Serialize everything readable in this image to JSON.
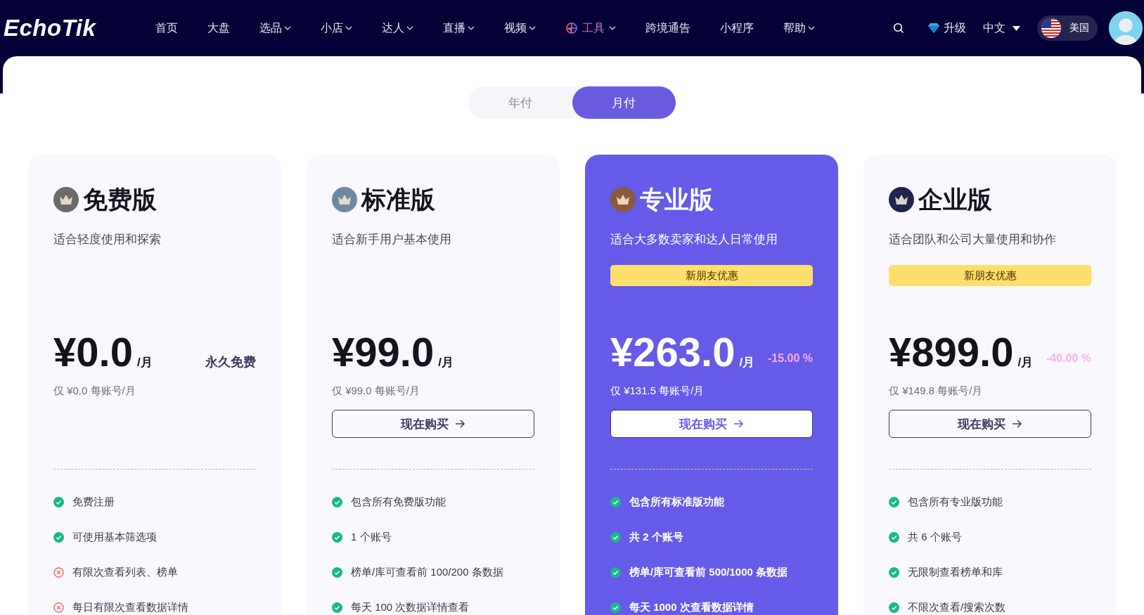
{
  "nav": {
    "logo": "EchoTik",
    "items": [
      {
        "label": "首页",
        "kind": "plain"
      },
      {
        "label": "大盘",
        "kind": "plain"
      },
      {
        "label": "选品",
        "kind": "dropdown"
      },
      {
        "label": "小店",
        "kind": "dropdown"
      },
      {
        "label": "达人",
        "kind": "dropdown"
      },
      {
        "label": "直播",
        "kind": "dropdown"
      },
      {
        "label": "视频",
        "kind": "dropdown"
      },
      {
        "label": "工具",
        "kind": "featured"
      },
      {
        "label": "跨境通告",
        "kind": "plain"
      },
      {
        "label": "小程序",
        "kind": "plain"
      },
      {
        "label": "帮助",
        "kind": "dropdown"
      }
    ],
    "upgrade": "升级",
    "language": "中文",
    "region": "美国"
  },
  "billing_options": [
    {
      "label": "年付",
      "selected": false
    },
    {
      "label": "月付",
      "selected": true
    }
  ],
  "plans": [
    {
      "name": "免费版",
      "color": "#6b6b6b",
      "selected": false,
      "description": "适合轻度使用和探索",
      "price": "¥0.0",
      "unit": "/月",
      "note": "永久免费",
      "per_account": "仅 ¥0.0 每账号/月",
      "features": [
        {
          "text": "免费注册",
          "kind": "check"
        },
        {
          "text": "可使用基本筛选项",
          "kind": "check"
        },
        {
          "text": "有限次查看列表、榜单",
          "kind": "cross"
        },
        {
          "text": "每日有限次查看数据详情",
          "kind": "cross"
        }
      ]
    },
    {
      "name": "标准版",
      "color": "#6f89a3",
      "selected": false,
      "description": "适合新手用户基本使用",
      "price": "¥99.0",
      "unit": "/月",
      "per_account": "仅 ¥99.0 每账号/月",
      "button": "现在购买",
      "features": [
        {
          "text": "包含所有免费版功能",
          "kind": "check"
        },
        {
          "text": "1 个账号",
          "kind": "check"
        },
        {
          "text": "榜单/库可查看前 100/200 条数据",
          "kind": "check"
        },
        {
          "text": "每天 100 次数据详情查看",
          "kind": "check"
        }
      ]
    },
    {
      "name": "专业版",
      "color": "#8a5a3c",
      "selected": true,
      "description": "适合大多数卖家和达人日常使用",
      "badge": "新朋友优惠",
      "price": "¥263.0",
      "unit": "/月",
      "discount": "-15.00 %",
      "per_account": "仅 ¥131.5 每账号/月",
      "button": "现在购买",
      "features": [
        {
          "text": "包含所有标准版功能",
          "kind": "check"
        },
        {
          "text": "共 2 个账号",
          "kind": "check"
        },
        {
          "text": "榜单/库可查看前 500/1000 条数据",
          "kind": "check"
        },
        {
          "text": "每天 1000 次查看数据详情",
          "kind": "check"
        }
      ]
    },
    {
      "name": "企业版",
      "color": "#1f2350",
      "selected": false,
      "description": "适合团队和公司大量使用和协作",
      "badge": "新朋友优惠",
      "price": "¥899.0",
      "unit": "/月",
      "discount": "-40.00 %",
      "per_account": "仅 ¥149.8 每账号/月",
      "button": "现在购买",
      "features": [
        {
          "text": "包含所有专业版功能",
          "kind": "check"
        },
        {
          "text": "共 6 个账号",
          "kind": "check"
        },
        {
          "text": "无限制查看榜单和库",
          "kind": "check"
        },
        {
          "text": "不限次查看/搜索次数",
          "kind": "check"
        }
      ]
    }
  ]
}
